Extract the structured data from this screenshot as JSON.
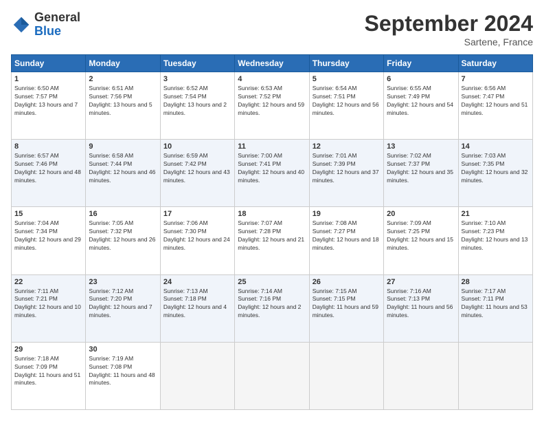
{
  "logo": {
    "general": "General",
    "blue": "Blue"
  },
  "title": "September 2024",
  "location": "Sartene, France",
  "weekdays": [
    "Sunday",
    "Monday",
    "Tuesday",
    "Wednesday",
    "Thursday",
    "Friday",
    "Saturday"
  ],
  "weeks": [
    [
      {
        "day": "1",
        "sunrise": "Sunrise: 6:50 AM",
        "sunset": "Sunset: 7:57 PM",
        "daylight": "Daylight: 13 hours and 7 minutes."
      },
      {
        "day": "2",
        "sunrise": "Sunrise: 6:51 AM",
        "sunset": "Sunset: 7:56 PM",
        "daylight": "Daylight: 13 hours and 5 minutes."
      },
      {
        "day": "3",
        "sunrise": "Sunrise: 6:52 AM",
        "sunset": "Sunset: 7:54 PM",
        "daylight": "Daylight: 13 hours and 2 minutes."
      },
      {
        "day": "4",
        "sunrise": "Sunrise: 6:53 AM",
        "sunset": "Sunset: 7:52 PM",
        "daylight": "Daylight: 12 hours and 59 minutes."
      },
      {
        "day": "5",
        "sunrise": "Sunrise: 6:54 AM",
        "sunset": "Sunset: 7:51 PM",
        "daylight": "Daylight: 12 hours and 56 minutes."
      },
      {
        "day": "6",
        "sunrise": "Sunrise: 6:55 AM",
        "sunset": "Sunset: 7:49 PM",
        "daylight": "Daylight: 12 hours and 54 minutes."
      },
      {
        "day": "7",
        "sunrise": "Sunrise: 6:56 AM",
        "sunset": "Sunset: 7:47 PM",
        "daylight": "Daylight: 12 hours and 51 minutes."
      }
    ],
    [
      {
        "day": "8",
        "sunrise": "Sunrise: 6:57 AM",
        "sunset": "Sunset: 7:46 PM",
        "daylight": "Daylight: 12 hours and 48 minutes."
      },
      {
        "day": "9",
        "sunrise": "Sunrise: 6:58 AM",
        "sunset": "Sunset: 7:44 PM",
        "daylight": "Daylight: 12 hours and 46 minutes."
      },
      {
        "day": "10",
        "sunrise": "Sunrise: 6:59 AM",
        "sunset": "Sunset: 7:42 PM",
        "daylight": "Daylight: 12 hours and 43 minutes."
      },
      {
        "day": "11",
        "sunrise": "Sunrise: 7:00 AM",
        "sunset": "Sunset: 7:41 PM",
        "daylight": "Daylight: 12 hours and 40 minutes."
      },
      {
        "day": "12",
        "sunrise": "Sunrise: 7:01 AM",
        "sunset": "Sunset: 7:39 PM",
        "daylight": "Daylight: 12 hours and 37 minutes."
      },
      {
        "day": "13",
        "sunrise": "Sunrise: 7:02 AM",
        "sunset": "Sunset: 7:37 PM",
        "daylight": "Daylight: 12 hours and 35 minutes."
      },
      {
        "day": "14",
        "sunrise": "Sunrise: 7:03 AM",
        "sunset": "Sunset: 7:35 PM",
        "daylight": "Daylight: 12 hours and 32 minutes."
      }
    ],
    [
      {
        "day": "15",
        "sunrise": "Sunrise: 7:04 AM",
        "sunset": "Sunset: 7:34 PM",
        "daylight": "Daylight: 12 hours and 29 minutes."
      },
      {
        "day": "16",
        "sunrise": "Sunrise: 7:05 AM",
        "sunset": "Sunset: 7:32 PM",
        "daylight": "Daylight: 12 hours and 26 minutes."
      },
      {
        "day": "17",
        "sunrise": "Sunrise: 7:06 AM",
        "sunset": "Sunset: 7:30 PM",
        "daylight": "Daylight: 12 hours and 24 minutes."
      },
      {
        "day": "18",
        "sunrise": "Sunrise: 7:07 AM",
        "sunset": "Sunset: 7:28 PM",
        "daylight": "Daylight: 12 hours and 21 minutes."
      },
      {
        "day": "19",
        "sunrise": "Sunrise: 7:08 AM",
        "sunset": "Sunset: 7:27 PM",
        "daylight": "Daylight: 12 hours and 18 minutes."
      },
      {
        "day": "20",
        "sunrise": "Sunrise: 7:09 AM",
        "sunset": "Sunset: 7:25 PM",
        "daylight": "Daylight: 12 hours and 15 minutes."
      },
      {
        "day": "21",
        "sunrise": "Sunrise: 7:10 AM",
        "sunset": "Sunset: 7:23 PM",
        "daylight": "Daylight: 12 hours and 13 minutes."
      }
    ],
    [
      {
        "day": "22",
        "sunrise": "Sunrise: 7:11 AM",
        "sunset": "Sunset: 7:21 PM",
        "daylight": "Daylight: 12 hours and 10 minutes."
      },
      {
        "day": "23",
        "sunrise": "Sunrise: 7:12 AM",
        "sunset": "Sunset: 7:20 PM",
        "daylight": "Daylight: 12 hours and 7 minutes."
      },
      {
        "day": "24",
        "sunrise": "Sunrise: 7:13 AM",
        "sunset": "Sunset: 7:18 PM",
        "daylight": "Daylight: 12 hours and 4 minutes."
      },
      {
        "day": "25",
        "sunrise": "Sunrise: 7:14 AM",
        "sunset": "Sunset: 7:16 PM",
        "daylight": "Daylight: 12 hours and 2 minutes."
      },
      {
        "day": "26",
        "sunrise": "Sunrise: 7:15 AM",
        "sunset": "Sunset: 7:15 PM",
        "daylight": "Daylight: 11 hours and 59 minutes."
      },
      {
        "day": "27",
        "sunrise": "Sunrise: 7:16 AM",
        "sunset": "Sunset: 7:13 PM",
        "daylight": "Daylight: 11 hours and 56 minutes."
      },
      {
        "day": "28",
        "sunrise": "Sunrise: 7:17 AM",
        "sunset": "Sunset: 7:11 PM",
        "daylight": "Daylight: 11 hours and 53 minutes."
      }
    ],
    [
      {
        "day": "29",
        "sunrise": "Sunrise: 7:18 AM",
        "sunset": "Sunset: 7:09 PM",
        "daylight": "Daylight: 11 hours and 51 minutes."
      },
      {
        "day": "30",
        "sunrise": "Sunrise: 7:19 AM",
        "sunset": "Sunset: 7:08 PM",
        "daylight": "Daylight: 11 hours and 48 minutes."
      },
      null,
      null,
      null,
      null,
      null
    ]
  ]
}
